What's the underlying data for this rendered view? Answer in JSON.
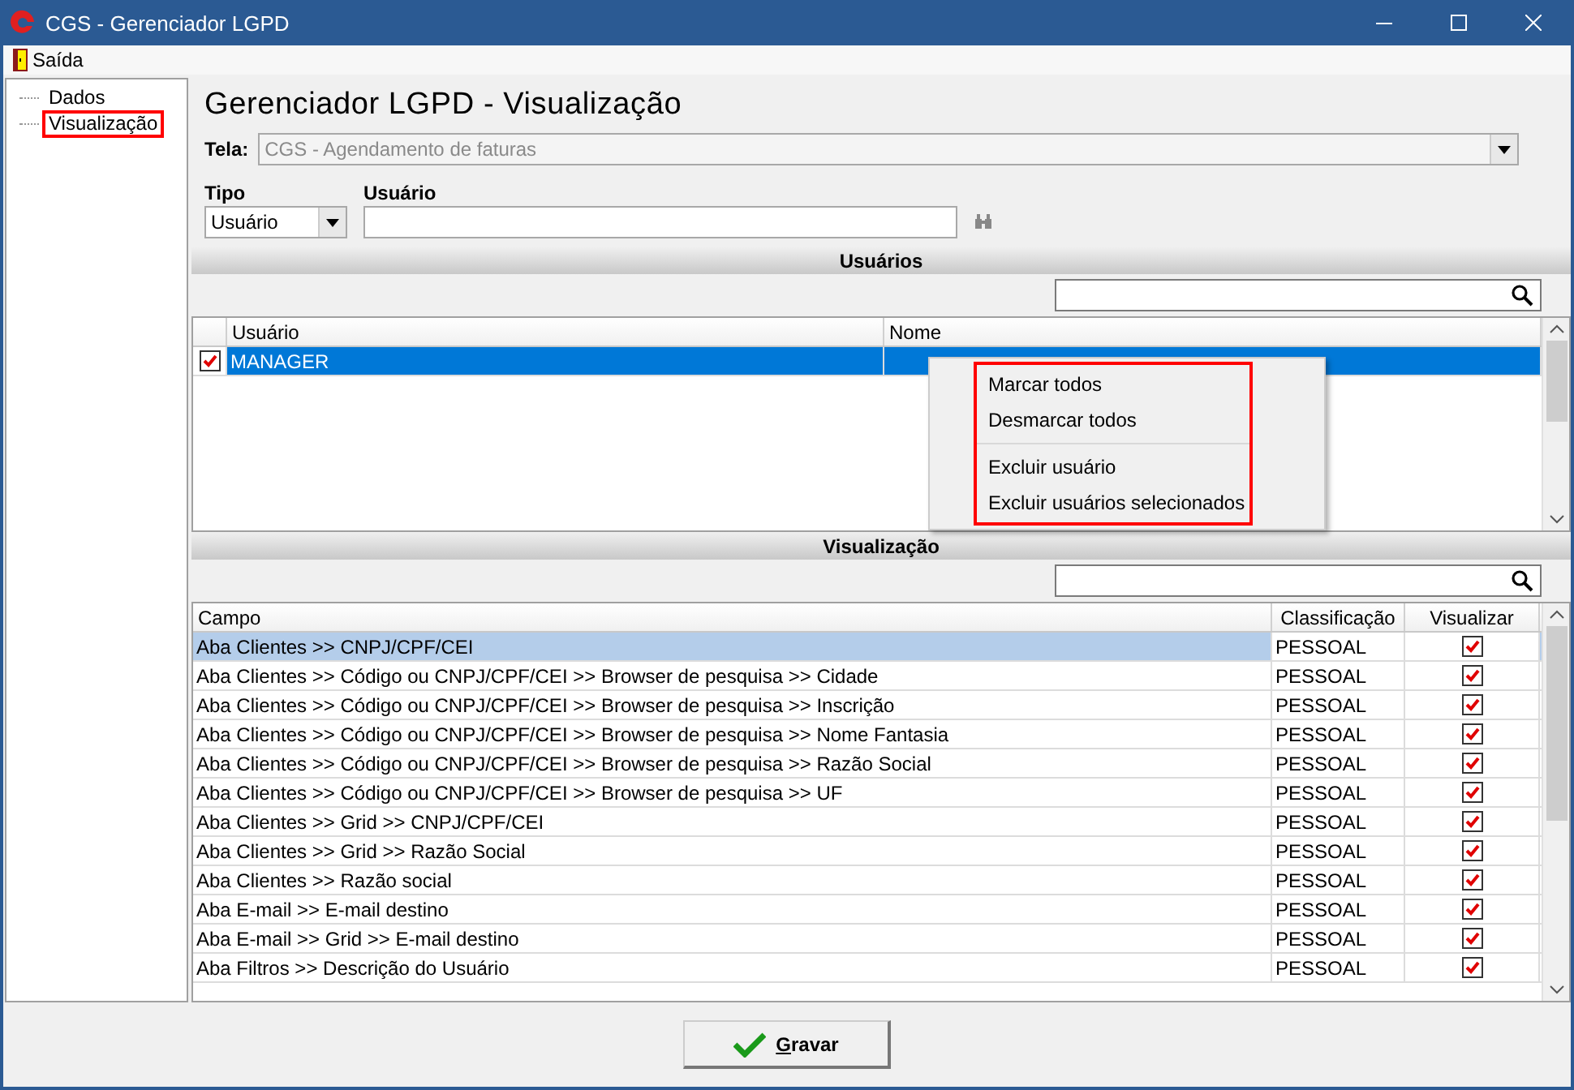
{
  "window": {
    "title": "CGS - Gerenciador LGPD"
  },
  "menu": [
    {
      "label": "Saída"
    }
  ],
  "tree": [
    {
      "label": "Dados",
      "highlighted": false
    },
    {
      "label": "Visualização",
      "highlighted": true
    }
  ],
  "heading": "Gerenciador LGPD - Visualização",
  "tela": {
    "label": "Tela:",
    "value": "CGS - Agendamento de faturas",
    "disabled": true
  },
  "tipo": {
    "label": "Tipo",
    "value": "Usuário"
  },
  "usuario": {
    "label": "Usuário"
  },
  "users": {
    "title": "Usuários",
    "columns": [
      "Usuário",
      "Nome"
    ],
    "rows": [
      {
        "checked": true,
        "selected": true,
        "usuario": "MANAGER",
        "nome": ""
      }
    ]
  },
  "context_menu": {
    "highlighted": true,
    "groups": [
      {
        "items": [
          "Marcar todos",
          "Desmarcar todos"
        ]
      },
      {
        "items": [
          "Excluir usuário",
          "Excluir usuários selecionados"
        ]
      }
    ]
  },
  "visualizacao": {
    "title": "Visualização",
    "columns": [
      "Campo",
      "Classificação",
      "Visualizar"
    ],
    "rows": [
      {
        "campo": "Aba Clientes >> CNPJ/CPF/CEI",
        "classificacao": "PESSOAL",
        "visualizar": true,
        "selected": true
      },
      {
        "campo": "Aba Clientes >> Código ou CNPJ/CPF/CEI >> Browser de pesquisa >> Cidade",
        "classificacao": "PESSOAL",
        "visualizar": true,
        "selected": false
      },
      {
        "campo": "Aba Clientes >> Código ou CNPJ/CPF/CEI >> Browser de pesquisa >> Inscrição",
        "classificacao": "PESSOAL",
        "visualizar": true,
        "selected": false
      },
      {
        "campo": "Aba Clientes >> Código ou CNPJ/CPF/CEI >> Browser de pesquisa >> Nome Fantasia",
        "classificacao": "PESSOAL",
        "visualizar": true,
        "selected": false
      },
      {
        "campo": "Aba Clientes >> Código ou CNPJ/CPF/CEI >> Browser de pesquisa >> Razão Social",
        "classificacao": "PESSOAL",
        "visualizar": true,
        "selected": false
      },
      {
        "campo": "Aba Clientes >> Código ou CNPJ/CPF/CEI >> Browser de pesquisa >> UF",
        "classificacao": "PESSOAL",
        "visualizar": true,
        "selected": false
      },
      {
        "campo": "Aba Clientes >> Grid >> CNPJ/CPF/CEI",
        "classificacao": "PESSOAL",
        "visualizar": true,
        "selected": false
      },
      {
        "campo": "Aba Clientes >> Grid >> Razão Social",
        "classificacao": "PESSOAL",
        "visualizar": true,
        "selected": false
      },
      {
        "campo": "Aba Clientes >> Razão social",
        "classificacao": "PESSOAL",
        "visualizar": true,
        "selected": false
      },
      {
        "campo": "Aba E-mail >> E-mail destino",
        "classificacao": "PESSOAL",
        "visualizar": true,
        "selected": false
      },
      {
        "campo": "Aba E-mail >> Grid >> E-mail destino",
        "classificacao": "PESSOAL",
        "visualizar": true,
        "selected": false
      },
      {
        "campo": "Aba Filtros >> Descrição do Usuário",
        "classificacao": "PESSOAL",
        "visualizar": true,
        "selected": false
      }
    ]
  },
  "save_button": {
    "label": "Gravar",
    "underline_first": true
  }
}
